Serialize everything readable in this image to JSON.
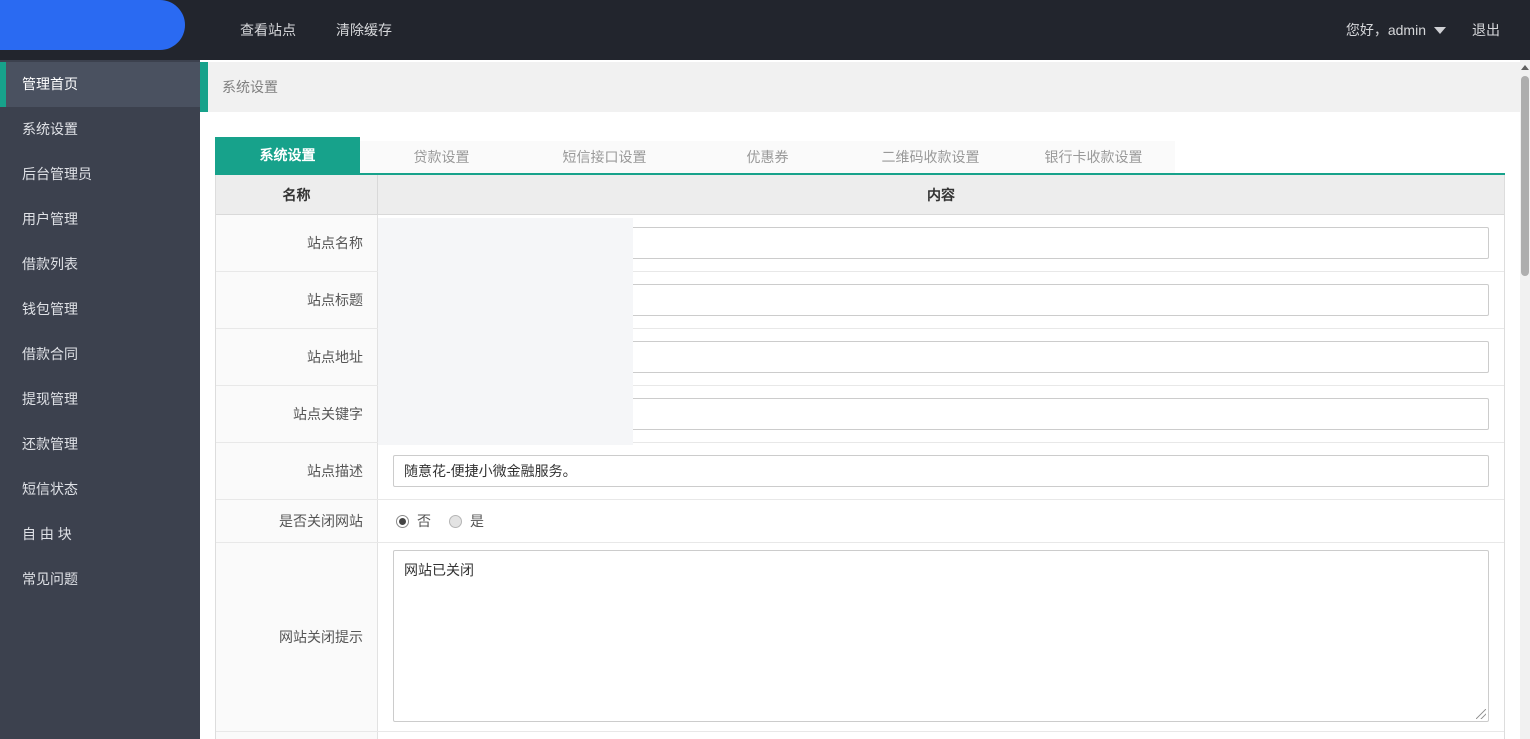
{
  "topbar": {
    "menu": [
      {
        "label": "查看站点"
      },
      {
        "label": "清除缓存"
      }
    ],
    "greeting": "您好，admin",
    "logout_label": "退出"
  },
  "sidebar": {
    "items": [
      {
        "label": "管理首页",
        "active": true
      },
      {
        "label": "系统设置",
        "active": false
      },
      {
        "label": "后台管理员",
        "active": false
      },
      {
        "label": "用户管理",
        "active": false
      },
      {
        "label": "借款列表",
        "active": false
      },
      {
        "label": "钱包管理",
        "active": false
      },
      {
        "label": "借款合同",
        "active": false
      },
      {
        "label": "提现管理",
        "active": false
      },
      {
        "label": "还款管理",
        "active": false
      },
      {
        "label": "短信状态",
        "active": false
      },
      {
        "label": "自 由 块",
        "active": false
      },
      {
        "label": "常见问题",
        "active": false
      }
    ]
  },
  "breadcrumb": {
    "title": "系统设置"
  },
  "tabs": [
    {
      "label": "系统设置",
      "active": true
    },
    {
      "label": "贷款设置",
      "active": false
    },
    {
      "label": "短信接口设置",
      "active": false
    },
    {
      "label": "优惠券",
      "active": false
    },
    {
      "label": "二维码收款设置",
      "active": false
    },
    {
      "label": "银行卡收款设置",
      "active": false
    }
  ],
  "table": {
    "headers": {
      "name": "名称",
      "content": "内容"
    },
    "rows": [
      {
        "label": "站点名称",
        "type": "input",
        "value": ""
      },
      {
        "label": "站点标题",
        "type": "input",
        "value": ""
      },
      {
        "label": "站点地址",
        "type": "input",
        "value": ""
      },
      {
        "label": "站点关键字",
        "type": "input",
        "value": ""
      },
      {
        "label": "站点描述",
        "type": "input",
        "value": "随意花-便捷小微金融服务。"
      },
      {
        "label": "是否关闭网站",
        "type": "radio",
        "options": [
          {
            "label": "否",
            "checked": true
          },
          {
            "label": "是",
            "checked": false
          }
        ]
      },
      {
        "label": "网站关闭提示",
        "type": "textarea",
        "value": "网站已关闭"
      }
    ]
  },
  "colors": {
    "accent_teal": "#17a28b",
    "logo_blue": "#2a6af2",
    "topbar_bg": "#22252d",
    "sidebar_bg": "#3c414e",
    "sidebar_active_bg": "#4a5160"
  }
}
